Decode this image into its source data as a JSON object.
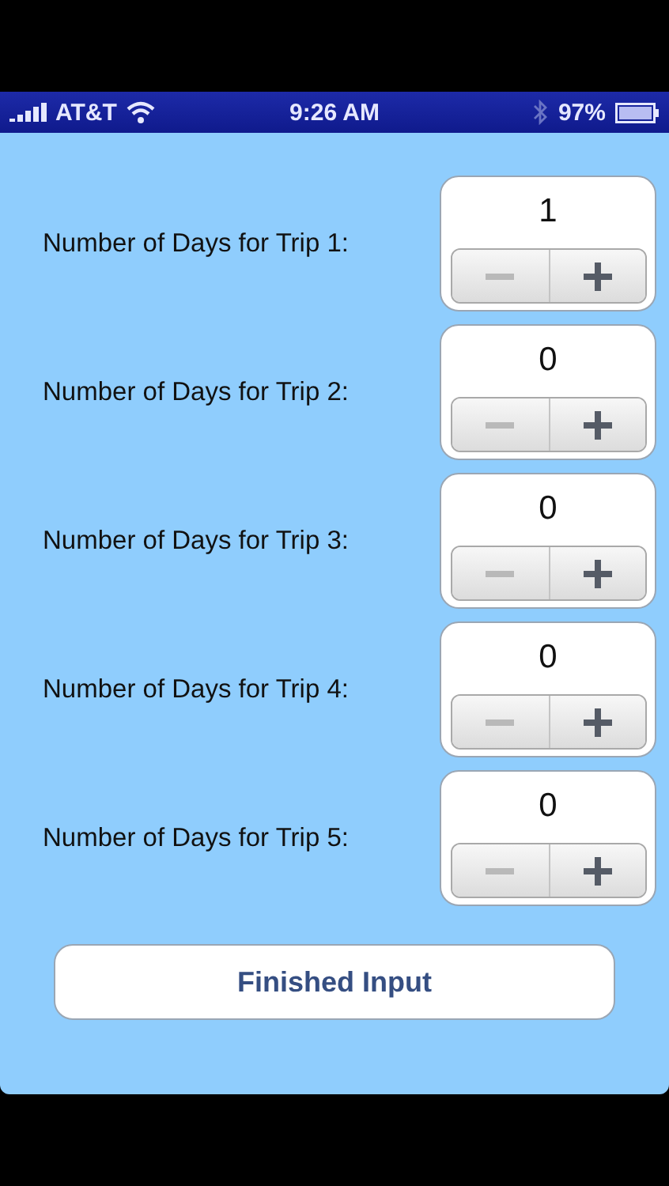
{
  "status_bar": {
    "carrier": "AT&T",
    "time": "9:26 AM",
    "battery": "97%"
  },
  "rows": [
    {
      "label": "Number of Days for Trip 1:",
      "value": "1",
      "minus_disabled": true
    },
    {
      "label": "Number of Days for Trip 2:",
      "value": "0",
      "minus_disabled": true
    },
    {
      "label": "Number of Days for Trip 3:",
      "value": "0",
      "minus_disabled": true
    },
    {
      "label": "Number of Days for Trip 4:",
      "value": "0",
      "minus_disabled": true
    },
    {
      "label": "Number of Days for Trip 5:",
      "value": "0",
      "minus_disabled": true
    }
  ],
  "button": "Finished Input"
}
